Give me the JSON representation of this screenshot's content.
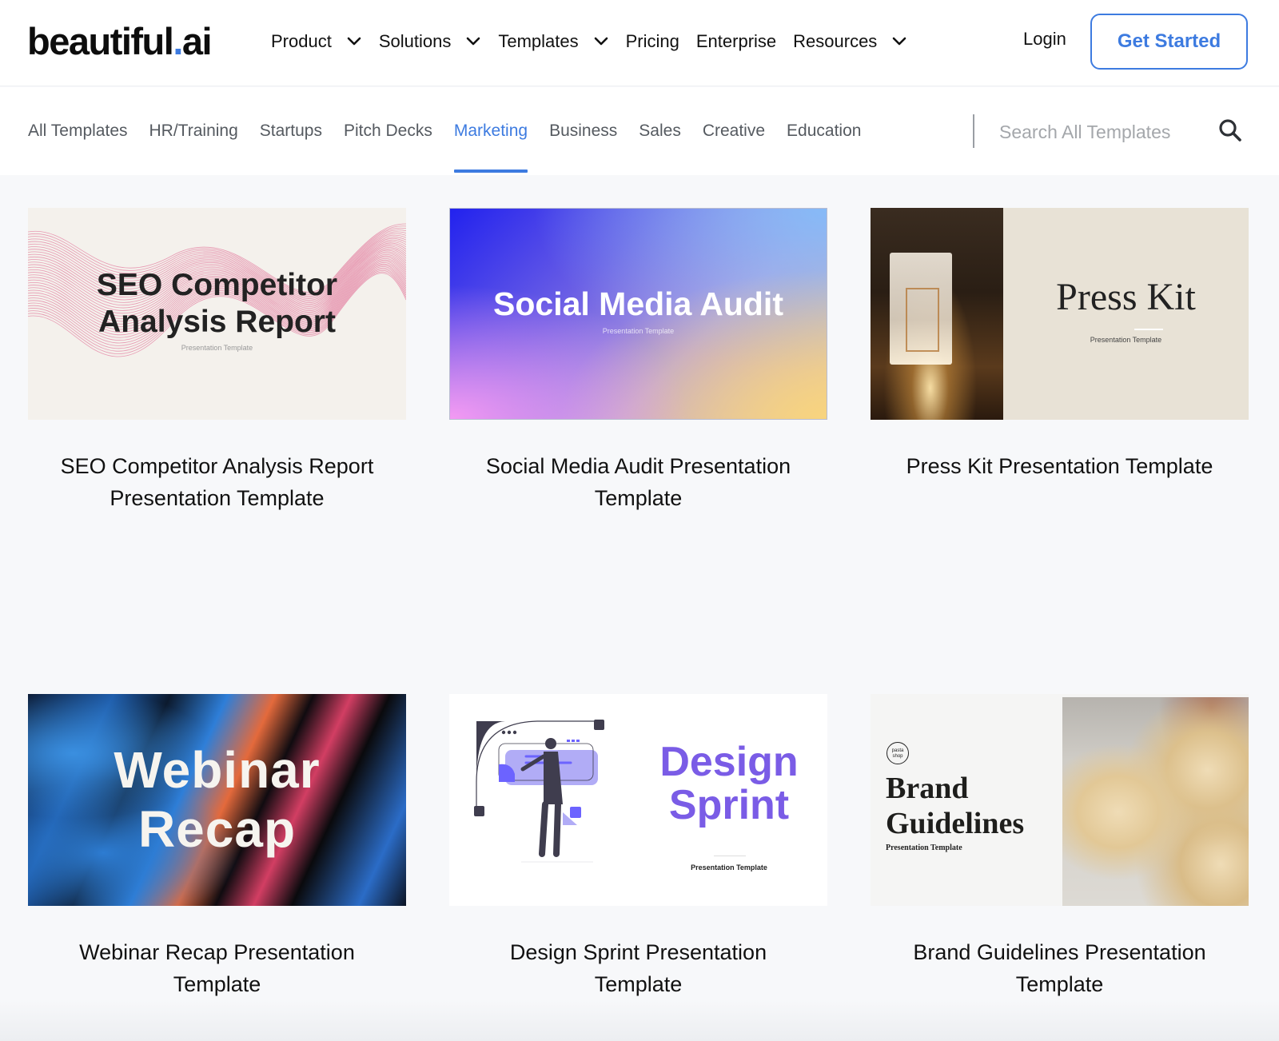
{
  "header": {
    "logo": {
      "text_main": "beautiful",
      "text_dot": ".",
      "text_suffix": "ai"
    },
    "nav": [
      {
        "label": "Product",
        "has_dropdown": true
      },
      {
        "label": "Solutions",
        "has_dropdown": true
      },
      {
        "label": "Templates",
        "has_dropdown": true
      },
      {
        "label": "Pricing",
        "has_dropdown": false
      },
      {
        "label": "Enterprise",
        "has_dropdown": false
      },
      {
        "label": "Resources",
        "has_dropdown": true
      }
    ],
    "login_label": "Login",
    "cta_label": "Get Started"
  },
  "categories": {
    "tabs": [
      {
        "label": "All Templates",
        "active": false
      },
      {
        "label": "HR/Training",
        "active": false
      },
      {
        "label": "Startups",
        "active": false
      },
      {
        "label": "Pitch Decks",
        "active": false
      },
      {
        "label": "Marketing",
        "active": true
      },
      {
        "label": "Business",
        "active": false
      },
      {
        "label": "Sales",
        "active": false
      },
      {
        "label": "Creative",
        "active": false
      },
      {
        "label": "Education",
        "active": false
      }
    ],
    "search": {
      "placeholder": "Search All Templates",
      "value": "",
      "icon": "search-icon"
    }
  },
  "templates": [
    {
      "title": "SEO Competitor Analysis Report Presentation Template",
      "thumb": {
        "headline_line1": "SEO Competitor",
        "headline_line2": "Analysis Report",
        "subtitle": "Presentation Template"
      }
    },
    {
      "title": "Social Media Audit Presentation Template",
      "thumb": {
        "headline": "Social Media Audit",
        "subtitle": "Presentation Template"
      }
    },
    {
      "title": "Press Kit Presentation Template",
      "thumb": {
        "headline": "Press Kit",
        "subtitle": "Presentation Template"
      }
    },
    {
      "title": "Webinar Recap Presentation Template",
      "thumb": {
        "headline_line1": "Webinar",
        "headline_line2": "Recap"
      }
    },
    {
      "title": "Design Sprint Presentation Template",
      "thumb": {
        "headline_line1": "Design",
        "headline_line2": "Sprint",
        "subtitle": "Presentation Template"
      }
    },
    {
      "title": "Brand Guidelines Presentation Template",
      "thumb": {
        "badge": "pasta shop",
        "headline_line1": "Brand",
        "headline_line2": "Guidelines",
        "subtitle": "Presentation Template"
      }
    }
  ],
  "colors": {
    "accent": "#3d7be0",
    "text_primary": "#111111",
    "tab_inactive": "#555a60",
    "page_bg": "#f7f8fa",
    "design_sprint_purple": "#7a5ce6"
  }
}
